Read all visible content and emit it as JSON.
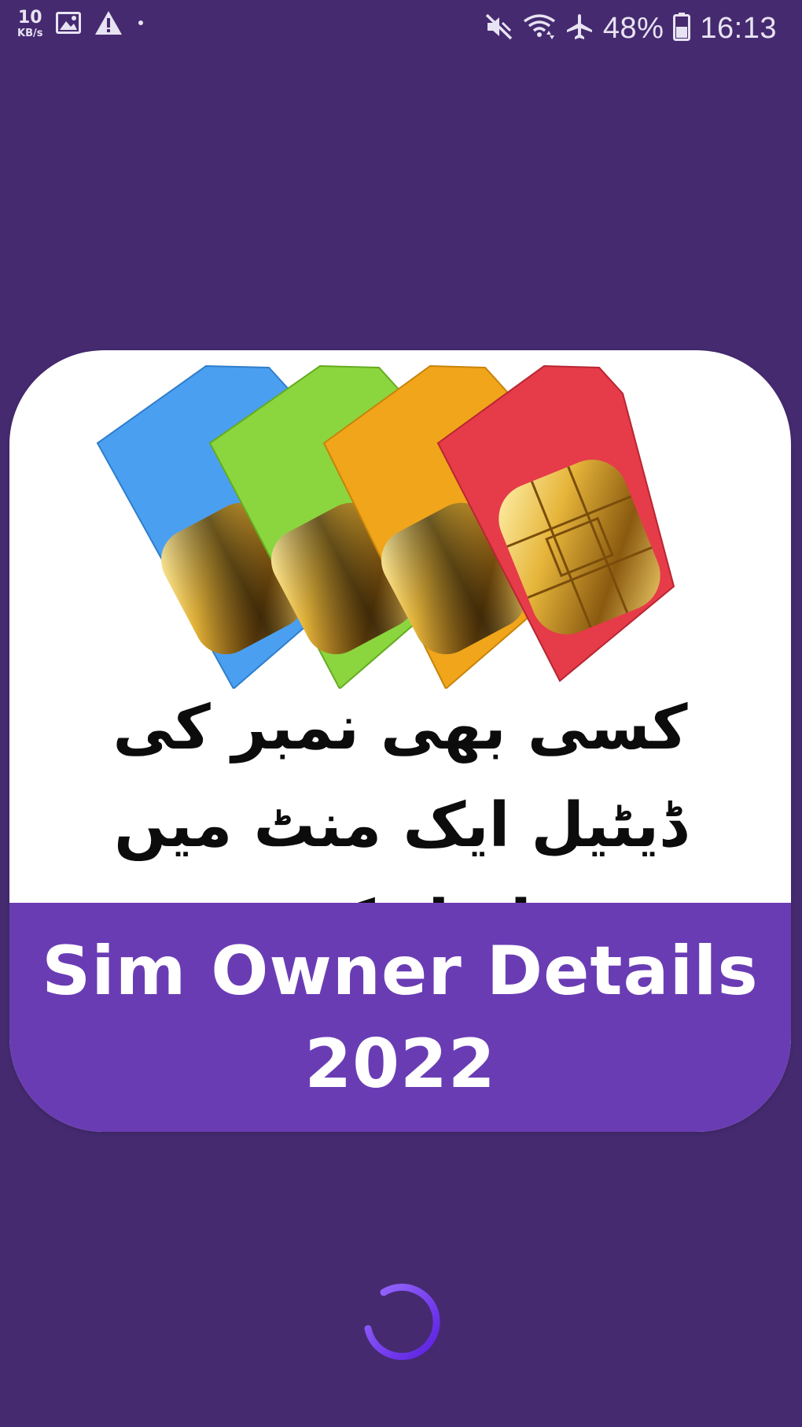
{
  "status_bar": {
    "net_speed_value": "10",
    "net_speed_unit": "KB/s",
    "battery_percent": "48%",
    "time": "16:13",
    "left_icons": [
      "gallery-icon",
      "warning-icon",
      "dot-icon"
    ],
    "right_icons": [
      "mute-icon",
      "wifi-icon",
      "airplane-icon",
      "battery-icon"
    ]
  },
  "splash": {
    "urdu_tagline_line1": "کسی بھی نمبر کی ڈیٹیل ایک منٹ میں",
    "urdu_tagline_line2": "حاصل کریں",
    "title_line1": "Sim Owner Details",
    "title_line2": "2022",
    "sim_cards": [
      {
        "color": "#4a9ff0",
        "name": "blue-sim-card"
      },
      {
        "color": "#8bd63e",
        "name": "green-sim-card"
      },
      {
        "color": "#f0a51a",
        "name": "orange-sim-card"
      },
      {
        "color": "#e63b48",
        "name": "red-sim-card"
      }
    ]
  },
  "colors": {
    "background": "#452a70",
    "title_band": "#6a3cb4",
    "spinner": "#6a2ee8"
  }
}
